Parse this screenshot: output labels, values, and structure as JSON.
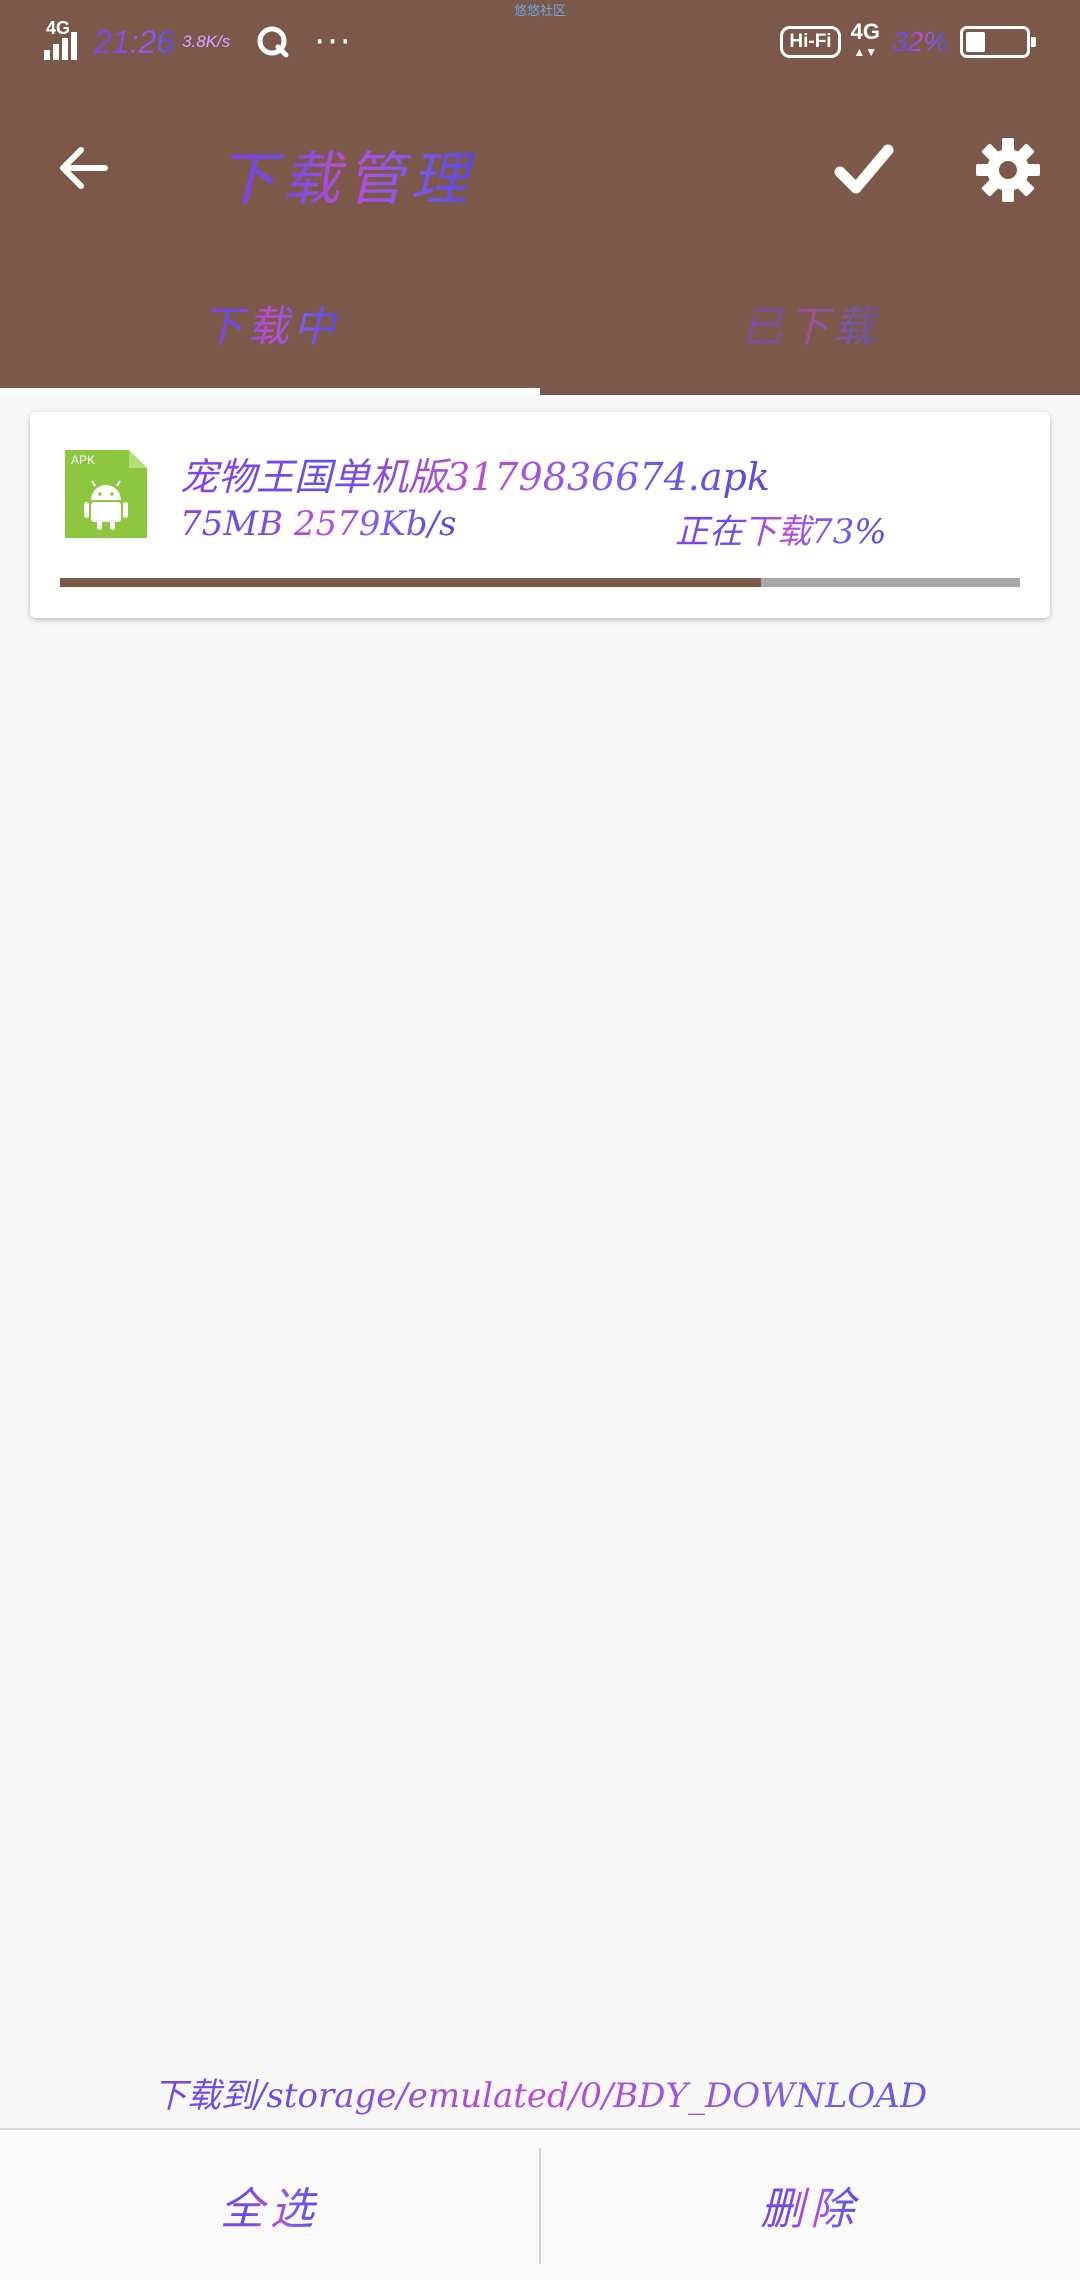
{
  "status_bar": {
    "network_left": "4G",
    "time": "21:26",
    "speed": "3.8K/s",
    "more": "···",
    "notch_label": "悠悠社区",
    "hifi": "Hi-Fi",
    "network_right": "4G",
    "battery_percent": "32%",
    "battery_level": 0.32
  },
  "toolbar": {
    "title": "下载管理",
    "back_icon": "arrow-left-icon",
    "confirm_icon": "checkmark-icon",
    "settings_icon": "gear-icon"
  },
  "tabs": [
    {
      "label": "下载中",
      "active": true
    },
    {
      "label": "已下载",
      "active": false
    }
  ],
  "downloads": [
    {
      "icon": "apk-android-icon",
      "icon_badge": "APK",
      "file_name": "宠物王国单机版3179836674.apk",
      "size_speed": "75MB 2579Kb/s",
      "status": "正在下载73%",
      "progress": 0.73
    }
  ],
  "footer": {
    "save_path": "下载到/storage/emulated/0/BDY_DOWNLOAD",
    "select_all": "全选",
    "delete": "删除"
  },
  "colors": {
    "primary": "#7b5849",
    "progress_track": "#a7a7a7",
    "apk_green": "#8dc63f"
  }
}
